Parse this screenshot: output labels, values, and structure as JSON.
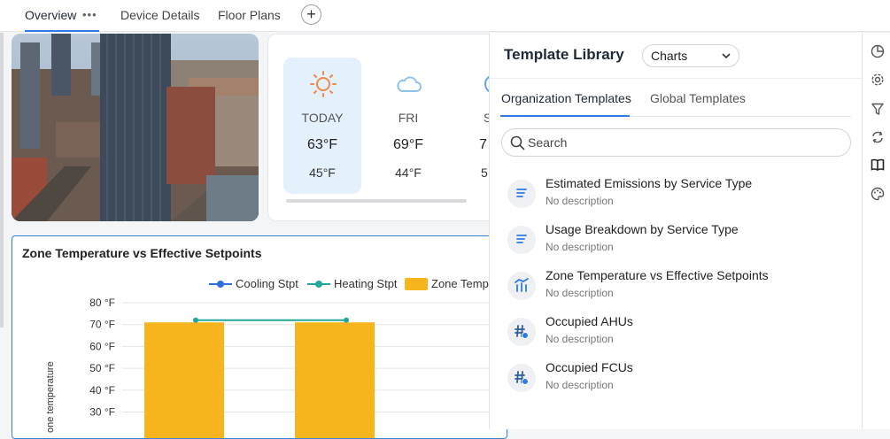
{
  "tabs": [
    {
      "label": "Overview",
      "active": true
    },
    {
      "label": "Device Details",
      "active": false
    },
    {
      "label": "Floor Plans",
      "active": false
    }
  ],
  "tab_menu_icon": "ellipsis-icon",
  "add_tab_icon": "plus-icon",
  "weather": {
    "days": [
      {
        "name": "TODAY",
        "high": "63°F",
        "low": "45°F",
        "icon": "sun-icon"
      },
      {
        "name": "FRI",
        "high": "69°F",
        "low": "44°F",
        "icon": "cloud-icon"
      },
      {
        "name": "S",
        "high": "7",
        "low": "5",
        "icon": "partial-icon"
      }
    ]
  },
  "chart": {
    "title": "Zone Temperature vs Effective Setpoints",
    "legend": [
      {
        "label": "Cooling Stpt",
        "color": "#2f6fdc"
      },
      {
        "label": "Heating Stpt",
        "color": "#26a69a"
      },
      {
        "label": "Zone Temp",
        "color": "#f8b41c"
      }
    ],
    "ylabel": "one temperature"
  },
  "chart_data": {
    "type": "bar",
    "title": "Zone Temperature vs Effective Setpoints",
    "ylabel": "one temperature",
    "ylim": [
      30,
      80
    ],
    "yticks": [
      "80 °F",
      "70 °F",
      "60 °F",
      "50 °F",
      "40 °F",
      "30 °F"
    ],
    "y_tick_values": [
      80,
      70,
      60,
      50,
      40,
      30
    ],
    "bars": [
      {
        "name": "Zone Temp",
        "values": [
          71,
          71
        ]
      }
    ],
    "lines": [
      {
        "name": "Heating Stpt",
        "values": [
          72,
          72
        ]
      }
    ],
    "grid": true,
    "legend": "top"
  },
  "panel": {
    "title": "Template Library",
    "select_value": "Charts",
    "tabs": [
      {
        "label": "Organization Templates",
        "active": true
      },
      {
        "label": "Global Templates",
        "active": false
      }
    ],
    "search_placeholder": "Search",
    "templates": [
      {
        "name": "Estimated Emissions by Service Type",
        "desc": "No description",
        "icon": "text-lines-icon"
      },
      {
        "name": "Usage Breakdown by Service Type",
        "desc": "No description",
        "icon": "text-lines-icon"
      },
      {
        "name": "Zone Temperature vs Effective Setpoints",
        "desc": "No description",
        "icon": "chart-icon"
      },
      {
        "name": "Occupied AHUs",
        "desc": "No description",
        "icon": "hash-icon"
      },
      {
        "name": "Occupied FCUs",
        "desc": "No description",
        "icon": "hash-icon"
      }
    ]
  },
  "rail_icons": [
    "pie-chart-icon",
    "gear-icon",
    "filter-icon",
    "refresh-icon",
    "book-icon",
    "palette-icon"
  ]
}
